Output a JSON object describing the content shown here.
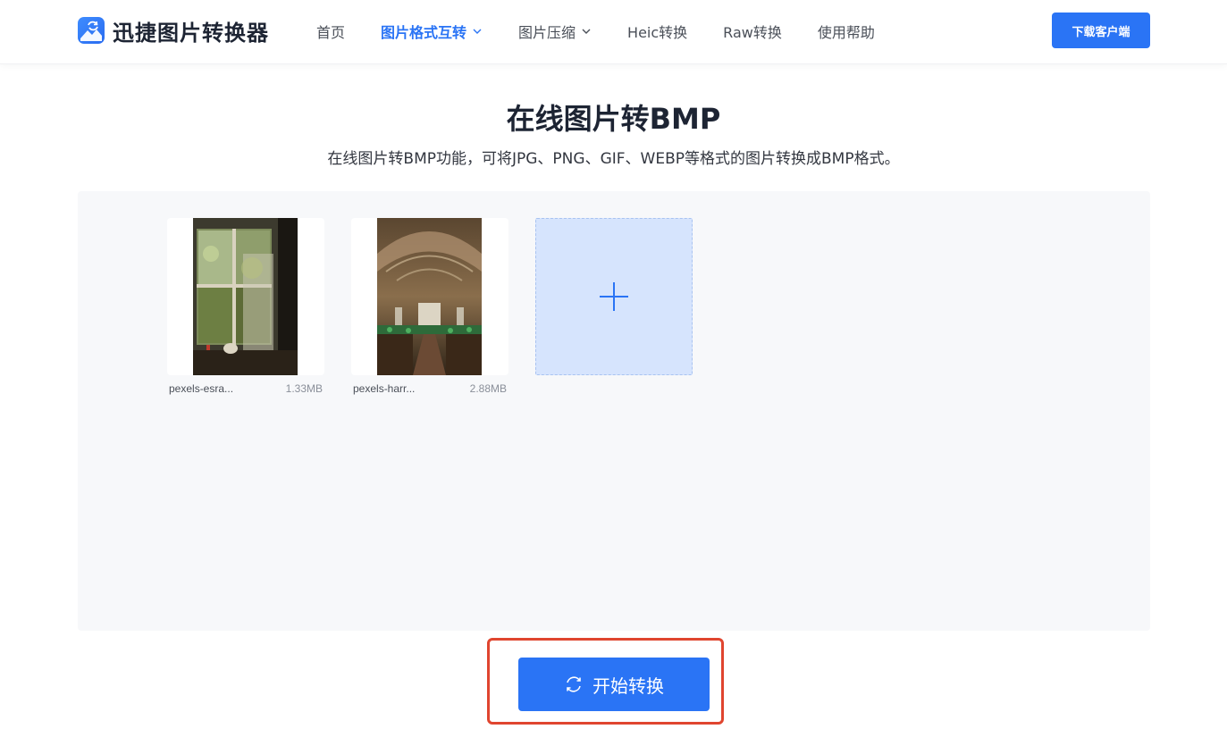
{
  "header": {
    "logo_text": "迅捷图片转换器",
    "download_label": "下载客户端",
    "nav": [
      {
        "label": "首页",
        "active": false,
        "dropdown": false
      },
      {
        "label": "图片格式互转",
        "active": true,
        "dropdown": true
      },
      {
        "label": "图片压缩",
        "active": false,
        "dropdown": true
      },
      {
        "label": "Heic转换",
        "active": false,
        "dropdown": false
      },
      {
        "label": "Raw转换",
        "active": false,
        "dropdown": false
      },
      {
        "label": "使用帮助",
        "active": false,
        "dropdown": false
      }
    ]
  },
  "page": {
    "title": "在线图片转BMP",
    "subtitle": "在线图片转BMP功能，可将JPG、PNG、GIF、WEBP等格式的图片转换成BMP格式。"
  },
  "files": [
    {
      "name": "pexels-esra...",
      "size": "1.33MB"
    },
    {
      "name": "pexels-harr...",
      "size": "2.88MB"
    }
  ],
  "actions": {
    "start_label": "开始转换"
  },
  "icons": {
    "logo": "image-sync-icon",
    "add": "plus-icon",
    "start": "refresh-icon",
    "dropdown": "chevron-down-icon"
  },
  "colors": {
    "accent": "#2a74f5",
    "panel_bg": "#f7f8fa",
    "add_tile_bg": "#d6e4fd",
    "highlight": "#e0452f"
  }
}
